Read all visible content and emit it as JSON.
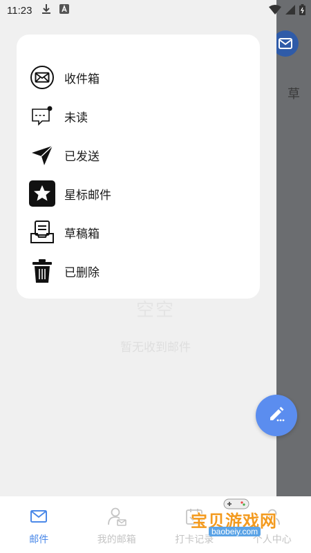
{
  "status_bar": {
    "time": "11:23"
  },
  "background": {
    "empty_title": "空空",
    "empty_hint": "暂无收到邮件",
    "side_text": "草"
  },
  "drawer": {
    "items": [
      {
        "label": "收件箱",
        "icon": "inbox-envelope-icon"
      },
      {
        "label": "未读",
        "icon": "unread-message-icon"
      },
      {
        "label": "已发送",
        "icon": "paper-plane-icon"
      },
      {
        "label": "星标邮件",
        "icon": "star-icon"
      },
      {
        "label": "草稿箱",
        "icon": "draft-tray-icon"
      },
      {
        "label": "已删除",
        "icon": "trash-icon"
      }
    ]
  },
  "fab": {
    "icon": "pencil-icon",
    "color": "#5b8def"
  },
  "bottom_nav": {
    "tabs": [
      {
        "label": "邮件",
        "icon": "mail-icon",
        "active": true
      },
      {
        "label": "我的邮箱",
        "icon": "person-mail-icon",
        "active": false
      },
      {
        "label": "打卡记录",
        "icon": "checkin-icon",
        "active": false
      },
      {
        "label": "个人中心",
        "icon": "profile-icon",
        "active": false
      }
    ],
    "active_color": "#4a88e8",
    "inactive_color": "#c4c4c4"
  },
  "watermark": {
    "title": "宝贝游戏网",
    "url": "baobeiy.com"
  }
}
